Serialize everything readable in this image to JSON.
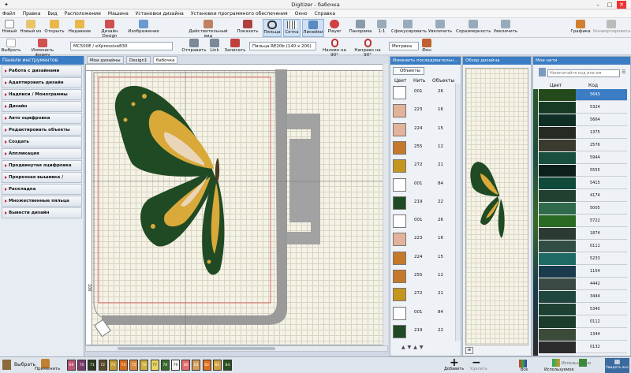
{
  "window": {
    "title": "Digitizer - бабочка"
  },
  "menu": [
    "Файл",
    "Правка",
    "Вид",
    "Расположение",
    "Машина",
    "Установки дизайна",
    "Установки программного обеспечения",
    "Окно",
    "Справка"
  ],
  "toolbar1": {
    "new": "Новый",
    "new_from": "Новый из",
    "open": "Открыть",
    "recent": "Недавние",
    "design_library": "Дизайн Design",
    "image": "Изображение",
    "realistic_view": "Действительный вид",
    "show": "Показать",
    "hoop": "Пяльца",
    "grid": "Сетка",
    "rulers": "Линейки",
    "player": "Player",
    "panorama": "Панорама",
    "ratio": "1:1",
    "focus": "Сфокусировать",
    "zoom_in": "Увеличить",
    "proportional": "Соразмерность",
    "zoom": "Увеличить",
    "zoom_value": "100",
    "zoom_unit": "%",
    "graphic": "Графика",
    "convert": "Конвертировать"
  },
  "toolbar2": {
    "select": "Выбрать",
    "edit_shape": "Изменить форму",
    "machine": "MC500E / eXpressive830",
    "send": "Отправить",
    "link": "Link",
    "save": "Записать",
    "hoop_select": "Пяльца RE20b (140 x 200)",
    "rotate_left": "Налево на 90°",
    "rotate_right": "Направо на 90°",
    "units": "Метрика",
    "background": "Фон"
  },
  "left_panel": {
    "header": "Панели инструментов",
    "items": [
      "Работа с дизайнами",
      "Адаптировать дизайн",
      "Надписи / Монограммы",
      "Дизайн",
      "Авто оцифровка",
      "Редактировать объекты",
      "Создать",
      "Аппликация",
      "Продвинутая оцифровка",
      "Прорезная вышивка / Работа ш...",
      "Раскладка",
      "Множественные пяльца",
      "Вывести дизайн"
    ]
  },
  "tabs": [
    "Мои дизайны",
    "Design1",
    "бабочка"
  ],
  "ruler": {
    "left_label": "100"
  },
  "sequence": {
    "header": "Изменить последовательн...",
    "objects_btn": "Объекты",
    "col_color": "Цвет",
    "col_thread": "Нить",
    "col_objects": "Объекты",
    "rows": [
      {
        "color": "#ffffff",
        "thread": "001",
        "objects": "26"
      },
      {
        "color": "#e2b39a",
        "thread": "223",
        "objects": "16"
      },
      {
        "color": "#e2b39a",
        "thread": "224",
        "objects": "15"
      },
      {
        "color": "#c47a2a",
        "thread": "255",
        "objects": "12"
      },
      {
        "color": "#c5961e",
        "thread": "272",
        "objects": "21"
      },
      {
        "color": "#ffffff",
        "thread": "001",
        "objects": "84"
      },
      {
        "color": "#1f4a23",
        "thread": "219",
        "objects": "22"
      },
      {
        "color": "#ffffff",
        "thread": "001",
        "objects": "26"
      },
      {
        "color": "#e2b39a",
        "thread": "223",
        "objects": "16"
      },
      {
        "color": "#c47a2a",
        "thread": "224",
        "objects": "15"
      },
      {
        "color": "#c47a2a",
        "thread": "255",
        "objects": "12"
      },
      {
        "color": "#c5961e",
        "thread": "272",
        "objects": "21"
      },
      {
        "color": "#ffffff",
        "thread": "001",
        "objects": "84"
      },
      {
        "color": "#1f4a23",
        "thread": "219",
        "objects": "22"
      }
    ]
  },
  "overview": {
    "header": "Обзор дизайна"
  },
  "threads": {
    "header": "Мои нити",
    "search_placeholder": "Напечатайте код или им",
    "col_color": "Цвет",
    "col_code": "Код",
    "rows": [
      {
        "color": "#244a1c",
        "code": "5643"
      },
      {
        "color": "#173b22",
        "code": "5324"
      },
      {
        "color": "#0f2e26",
        "code": "5664"
      },
      {
        "color": "#262a23",
        "code": "1375"
      },
      {
        "color": "#3b3a2e",
        "code": "2576"
      },
      {
        "color": "#1a4e3f",
        "code": "5944"
      },
      {
        "color": "#0d1f1a",
        "code": "5555"
      },
      {
        "color": "#0f4a3a",
        "code": "5415"
      },
      {
        "color": "#22402f",
        "code": "4174"
      },
      {
        "color": "#2f6a4c",
        "code": "5005"
      },
      {
        "color": "#2a6b23",
        "code": "5722"
      },
      {
        "color": "#2b3b33",
        "code": "1874"
      },
      {
        "color": "#314d44",
        "code": "0111"
      },
      {
        "color": "#1f6a63",
        "code": "5233"
      },
      {
        "color": "#1a3b4b",
        "code": "1154"
      },
      {
        "color": "#3b4a44",
        "code": "4442"
      },
      {
        "color": "#20463f",
        "code": "3444"
      },
      {
        "color": "#1d4233",
        "code": "5340"
      },
      {
        "color": "#1b3c2a",
        "code": "0112"
      },
      {
        "color": "#3c4a3a",
        "code": "1344"
      },
      {
        "color": "#2c2c2c",
        "code": "0132"
      }
    ]
  },
  "bottom": {
    "select": "Выбрать",
    "apply": "Применить",
    "add": "Добавить",
    "remove": "Удалить",
    "all": "Все",
    "used": "Использовано",
    "used_short": "Используемое",
    "view_all": "Увидеть все",
    "palette": [
      {
        "label": "69",
        "color": "#c0547a"
      },
      {
        "label": "70",
        "color": "#7a3a6a"
      },
      {
        "label": "71",
        "color": "#2a3a20"
      },
      {
        "label": "72",
        "color": "#5a4a2a"
      },
      {
        "label": "73",
        "color": "#c49a30"
      },
      {
        "label": "74",
        "color": "#d86a1e"
      },
      {
        "label": "75",
        "color": "#d88a3e"
      },
      {
        "label": "76",
        "color": "#c9b040"
      },
      {
        "label": "77",
        "color": "#e8d660"
      },
      {
        "label": "78",
        "color": "#3a6a2a"
      },
      {
        "label": "79",
        "color": "#f4f4f4"
      },
      {
        "label": "80",
        "color": "#e86a6a"
      },
      {
        "label": "81",
        "color": "#d4a060"
      },
      {
        "label": "82",
        "color": "#e07020"
      },
      {
        "label": "83",
        "color": "#d0a040"
      },
      {
        "label": "84",
        "color": "#2a5020"
      }
    ]
  }
}
